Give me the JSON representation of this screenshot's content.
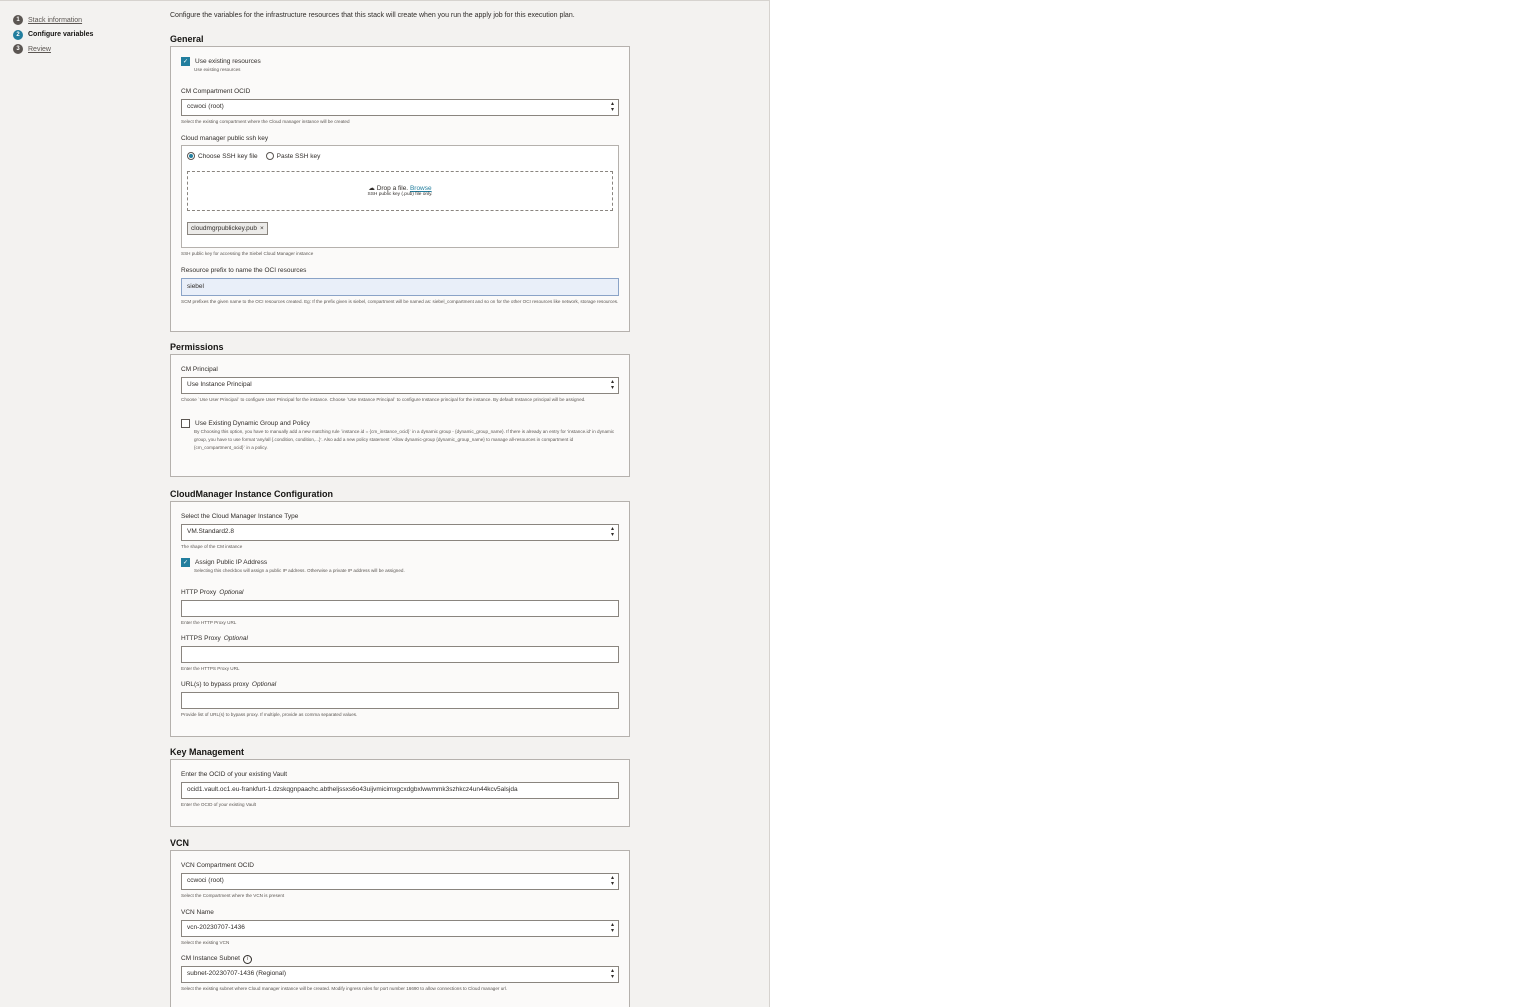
{
  "steps": [
    {
      "num": "1",
      "label": "Stack information"
    },
    {
      "num": "2",
      "label": "Configure variables"
    },
    {
      "num": "3",
      "label": "Review"
    }
  ],
  "intro": "Configure the variables for the infrastructure resources that this stack will create when you run the apply job for this execution plan.",
  "general": {
    "title": "General",
    "use_existing_label": "Use existing resources",
    "use_existing_help": "Use existing resources",
    "cm_compartment_label": "CM Compartment OCID",
    "cm_compartment_value": "ccwoci (root)",
    "cm_compartment_help": "Select the existing compartment where the Cloud manager instance will be created",
    "ssh_label": "Cloud manager public ssh key",
    "ssh_choose": "Choose SSH key file",
    "ssh_paste": "Paste SSH key",
    "drop_text": "Drop a file.",
    "browse": "Browse",
    "drop_hint": "SSH public key (.pub) file only.",
    "file_chip": "cloudmgrpublickey.pub",
    "ssh_help": "SSH public key for accessing the Siebel Cloud Manager instance",
    "prefix_label": "Resource prefix to name the OCI resources",
    "prefix_value": "siebel",
    "prefix_help": "SCM prefixes the given name to the OCI resources created. Eg: If the prefix given is siebel, compartment will be named as: siebel_compartment and so on for the other OCI resources like network, storage resources."
  },
  "permissions": {
    "title": "Permissions",
    "principal_label": "CM Principal",
    "principal_value": "Use Instance Principal",
    "principal_help": "Choose `Use User Principal` to configure User Principal for the instance. Choose `Use Instance Principal` to configure Instance principal for the instance. By default Instance principal will be assigned.",
    "dyn_label": "Use Existing Dynamic Group and Policy",
    "dyn_help": "By Choosing this option, you have to manually add a new matching rule `instance.id = {cm_instance_ocid}` in a dynamic group - {dynamic_group_name}. If there is already an entry for 'instance.id' in dynamic group, you have to use format 'any/all {.condition, condition,...}'. Also add a new policy statement `Allow dynamic-group {dynamic_group_name} to manage all-resources in compartment id {cm_compartment_ocid}` in a policy."
  },
  "cm_instance": {
    "title": "CloudManager Instance Configuration",
    "type_label": "Select the Cloud Manager Instance Type",
    "type_value": "VM.Standard2.8",
    "type_help": "The shape of the CM instance",
    "public_ip_label": "Assign Public IP Address",
    "public_ip_help": "Selecting this checkbox will assign a public IP address. Otherwise a private IP address will be assigned.",
    "optional": "Optional",
    "http_label": "HTTP Proxy",
    "http_help": "Enter the HTTP Proxy URL",
    "https_label": "HTTPS Proxy",
    "https_help": "Enter the HTTPS Proxy URL",
    "bypass_label": "URL(s) to bypass proxy",
    "bypass_help": "Provide list of URL(s) to bypass proxy. If multiple, provide as comma separated values."
  },
  "key_mgmt": {
    "title": "Key Management",
    "vault_label": "Enter the OCID of your existing Vault",
    "vault_value": "ocid1.vault.oc1.eu-frankfurt-1.dzskqgnpaachc.abtheljssxs6o43uijvmicimxgcxdgbxlwwmmk3szhkcz4un44kcv5alsjda",
    "vault_help": "Enter the OCID of your existing Vault"
  },
  "vcn": {
    "title": "VCN",
    "compartment_label": "VCN Compartment OCID",
    "compartment_value": "ccwoci (root)",
    "compartment_help": "Select the Compartment where the VCN is present",
    "name_label": "VCN Name",
    "name_value": "vcn-20230707-1436",
    "name_help": "Select the existing VCN",
    "subnet_label": "CM Instance Subnet",
    "subnet_value": "subnet-20230707-1436 (Regional)",
    "subnet_help": "Select the existing subnet where Cloud manager instance will be created. Modify ingress rules for port number 16690 to allow connections to Cloud manager url."
  },
  "colors": {
    "accent": "#227e9e",
    "panel_bg": "#f3f2f0",
    "box_bg": "#fbfaf9"
  },
  "icons": [
    "upload-cloud-icon",
    "close-icon",
    "info-icon",
    "chevron-updown-icon",
    "check-icon"
  ]
}
